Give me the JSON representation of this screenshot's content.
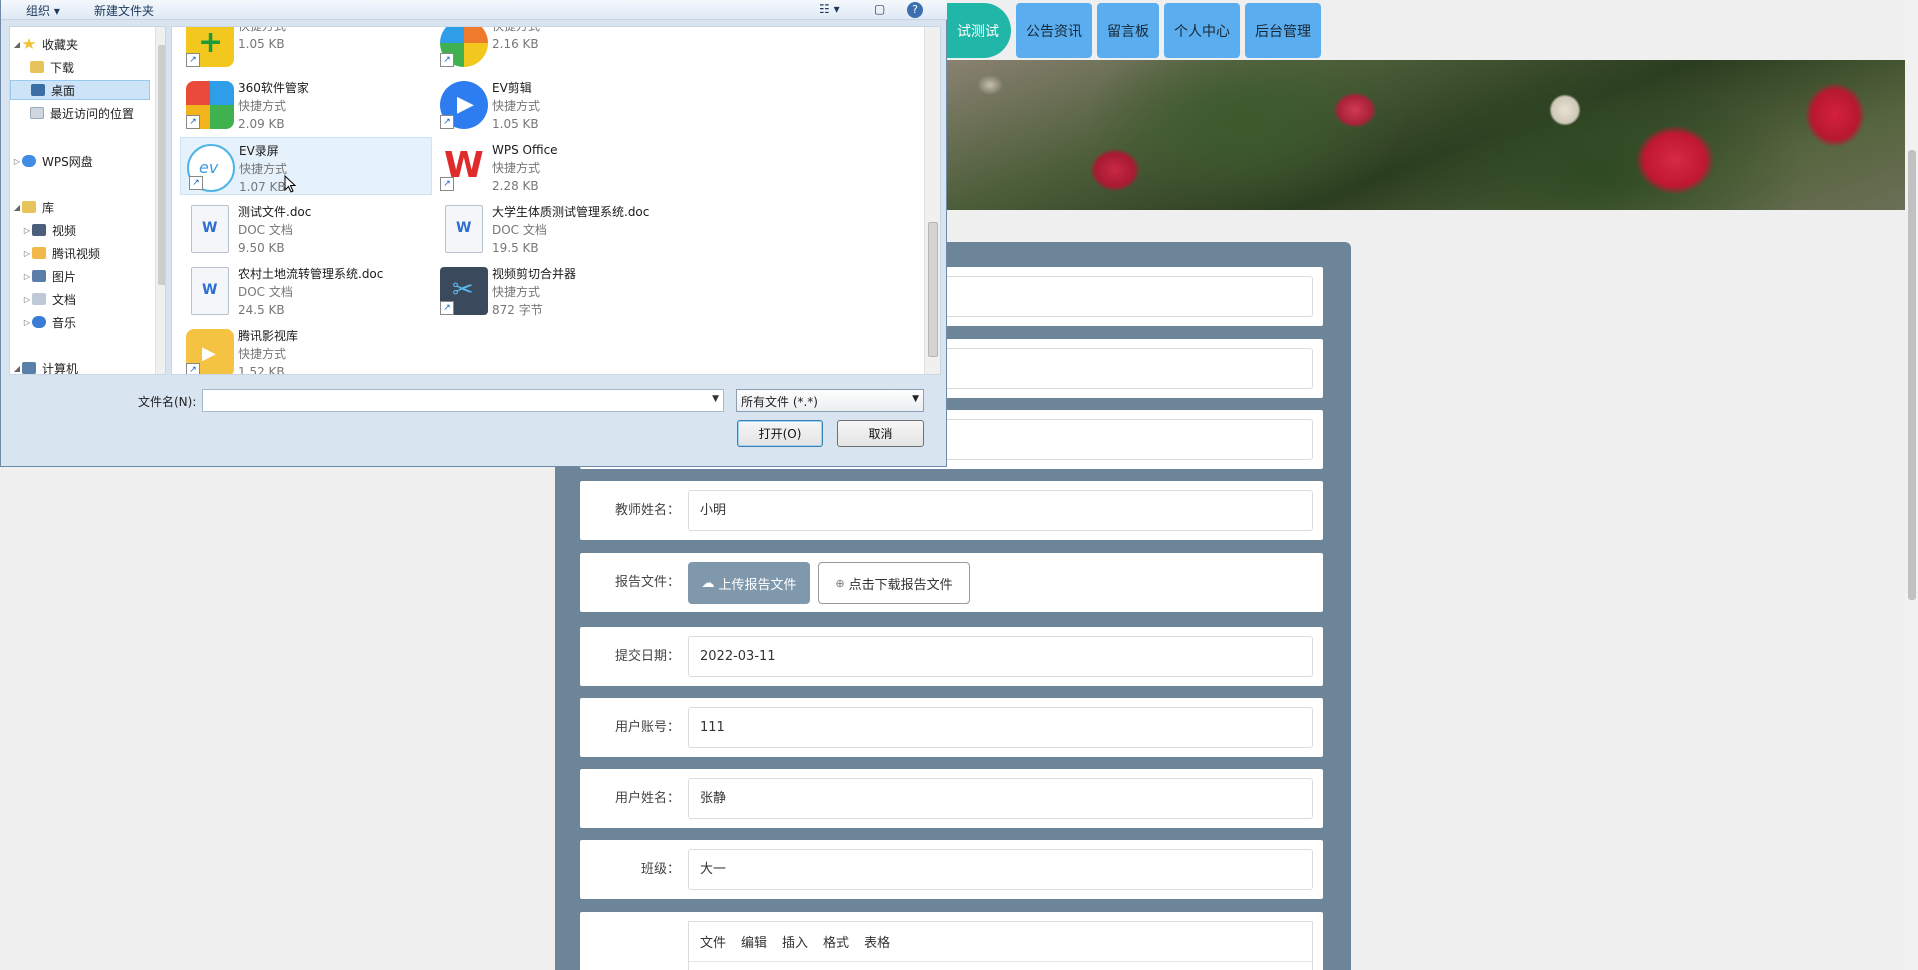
{
  "nav": {
    "items": [
      "在线测试",
      "公告资讯",
      "留言板",
      "个人中心",
      "后台管理"
    ],
    "active_visible": "试测试"
  },
  "form": {
    "teacher": {
      "label": "教师姓名：",
      "value": "小明"
    },
    "report": {
      "label": "报告文件：",
      "upload": "上传报告文件",
      "download": "点击下载报告文件"
    },
    "date": {
      "label": "提交日期：",
      "value": "2022-03-11"
    },
    "account": {
      "label": "用户账号：",
      "value": "111"
    },
    "username": {
      "label": "用户姓名：",
      "value": "张静"
    },
    "class": {
      "label": "班级：",
      "value": "大一"
    },
    "editor_menu": [
      "文件",
      "编辑",
      "插入",
      "格式",
      "表格"
    ]
  },
  "dialog": {
    "toolbar": {
      "organize": "组织 ▾",
      "new_folder": "新建文件夹"
    },
    "nav": [
      {
        "label": "收藏夹",
        "icon": "star-icon",
        "color": "#f1c232"
      },
      {
        "label": "下载",
        "icon": "download-folder-icon",
        "color": "#e7c35b"
      },
      {
        "label": "桌面",
        "icon": "desktop-icon",
        "color": "#3a6ea5"
      },
      {
        "label": "最近访问的位置",
        "icon": "recent-icon",
        "color": "#cfd8e2"
      },
      {
        "label": "WPS网盘",
        "icon": "cloud-icon",
        "color": "#3f8be5"
      },
      {
        "label": "库",
        "icon": "library-icon",
        "color": "#e7c35b"
      },
      {
        "label": "视频",
        "icon": "video-icon",
        "color": "#4c5f7a"
      },
      {
        "label": "腾讯视频",
        "icon": "tencent-video-icon",
        "color": "#f0b94a"
      },
      {
        "label": "图片",
        "icon": "picture-icon",
        "color": "#5b7ea8"
      },
      {
        "label": "文档",
        "icon": "document-icon",
        "color": "#bfc9d5"
      },
      {
        "label": "音乐",
        "icon": "music-icon",
        "color": "#3a7bd5"
      },
      {
        "label": "计算机",
        "icon": "computer-icon",
        "color": "#5a7fa8"
      }
    ],
    "files": [
      {
        "name": "",
        "type": "快捷方式",
        "size": "1.05 KB",
        "icon": "green-plus-icon",
        "color": "#f2c81e"
      },
      {
        "name": "",
        "type": "快捷方式",
        "size": "2.16 KB",
        "icon": "color-wheel-icon",
        "color": "#f07a2b"
      },
      {
        "name": "360软件管家",
        "type": "快捷方式",
        "size": "2.09 KB",
        "icon": "360-icon",
        "color": "#3fb24f"
      },
      {
        "name": "EV剪辑",
        "type": "快捷方式",
        "size": "1.05 KB",
        "icon": "ev-edit-icon",
        "color": "#2d7df0"
      },
      {
        "name": "EV录屏",
        "type": "快捷方式",
        "size": "1.07 KB",
        "icon": "ev-record-icon",
        "color": "#ffffff"
      },
      {
        "name": "WPS Office",
        "type": "快捷方式",
        "size": "2.28 KB",
        "icon": "wps-icon",
        "color": "#e02b2b"
      },
      {
        "name": "测试文件.doc",
        "type": "DOC 文档",
        "size": "9.50 KB",
        "icon": "doc-icon",
        "color": "#f4f6f9"
      },
      {
        "name": "大学生体质测试管理系统.doc",
        "type": "DOC 文档",
        "size": "19.5 KB",
        "icon": "doc-icon",
        "color": "#f4f6f9"
      },
      {
        "name": "农村土地流转管理系统.doc",
        "type": "DOC 文档",
        "size": "24.5 KB",
        "icon": "doc-icon",
        "color": "#f4f6f9"
      },
      {
        "name": "视频剪切合并器",
        "type": "快捷方式",
        "size": "872 字节",
        "icon": "scissors-icon",
        "color": "#3a4a5c"
      },
      {
        "name": "腾讯影视库",
        "type": "快捷方式",
        "size": "1.52 KB",
        "icon": "tencent-folder-icon",
        "color": "#f5c342"
      }
    ],
    "filename_label": "文件名(N):",
    "filename_value": "",
    "filter": "所有文件 (*.*)",
    "open": "打开(O)",
    "cancel": "取消"
  }
}
